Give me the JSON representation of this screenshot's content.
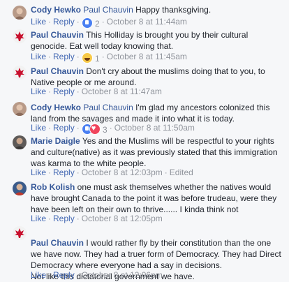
{
  "labels": {
    "like": "Like",
    "reply": "Reply",
    "sep": "·"
  },
  "colors": {
    "author": "#365899",
    "link": "#4267b2",
    "meta": "#90949c",
    "background": "#f6f7f9"
  },
  "comments": [
    {
      "author": "Cody Hewko",
      "mention": "Paul Chauvin",
      "text": "Happy thanksgiving.",
      "reaction_icons": [
        "like-icon"
      ],
      "reaction_count": "2",
      "time": "October 8 at 11:44am",
      "edited": ""
    },
    {
      "author": "Paul Chauvin",
      "mention": "",
      "text": "This Holliday is brought you by their cultural genocide. Eat well today knowing that.",
      "reaction_icons": [
        "haha-icon"
      ],
      "reaction_count": "1",
      "time": "October 8 at 11:45am",
      "edited": ""
    },
    {
      "author": "Paul Chauvin",
      "mention": "",
      "text": "Don't cry about the muslims doing that to you, to Native people or me around.",
      "reaction_icons": [],
      "reaction_count": "",
      "time": "October 8 at 11:47am",
      "edited": ""
    },
    {
      "author": "Cody Hewko",
      "mention": "Paul Chauvin",
      "text": "I'm glad my ancestors colonized this land from the savages and made it into what it is today.",
      "reaction_icons": [
        "like-icon",
        "love-icon"
      ],
      "reaction_count": "3",
      "time": "October 8 at 11:50am",
      "edited": ""
    },
    {
      "author": "Marie Daigle",
      "mention": "",
      "text": "Yes and the Muslims will be respectful to your rights and culture(native) as it was previously stated that this immigration was karma to the white people.",
      "reaction_icons": [],
      "reaction_count": "",
      "time": "October 8 at 12:03pm",
      "edited": "Edited"
    },
    {
      "author": "Rob Kolish",
      "mention": "",
      "text": "one must ask themselves whether the natives would have brought Canada to the point it was before trudeau, were they have been left on their own to thrive...... I kinda think not",
      "reaction_icons": [],
      "reaction_count": "",
      "time": "October 8 at 12:05pm",
      "edited": ""
    },
    {
      "author": "Paul Chauvin",
      "mention": "",
      "text": "I would rather fly by their constitution than the one we have now. They had a truer form of Democracy. They had Direct Democracy where everyone had a say in decisions.\nNot like this dictatorial government we have.",
      "reaction_icons": [],
      "reaction_count": "",
      "time": "October 8 at 12:06pm",
      "edited": ""
    }
  ]
}
